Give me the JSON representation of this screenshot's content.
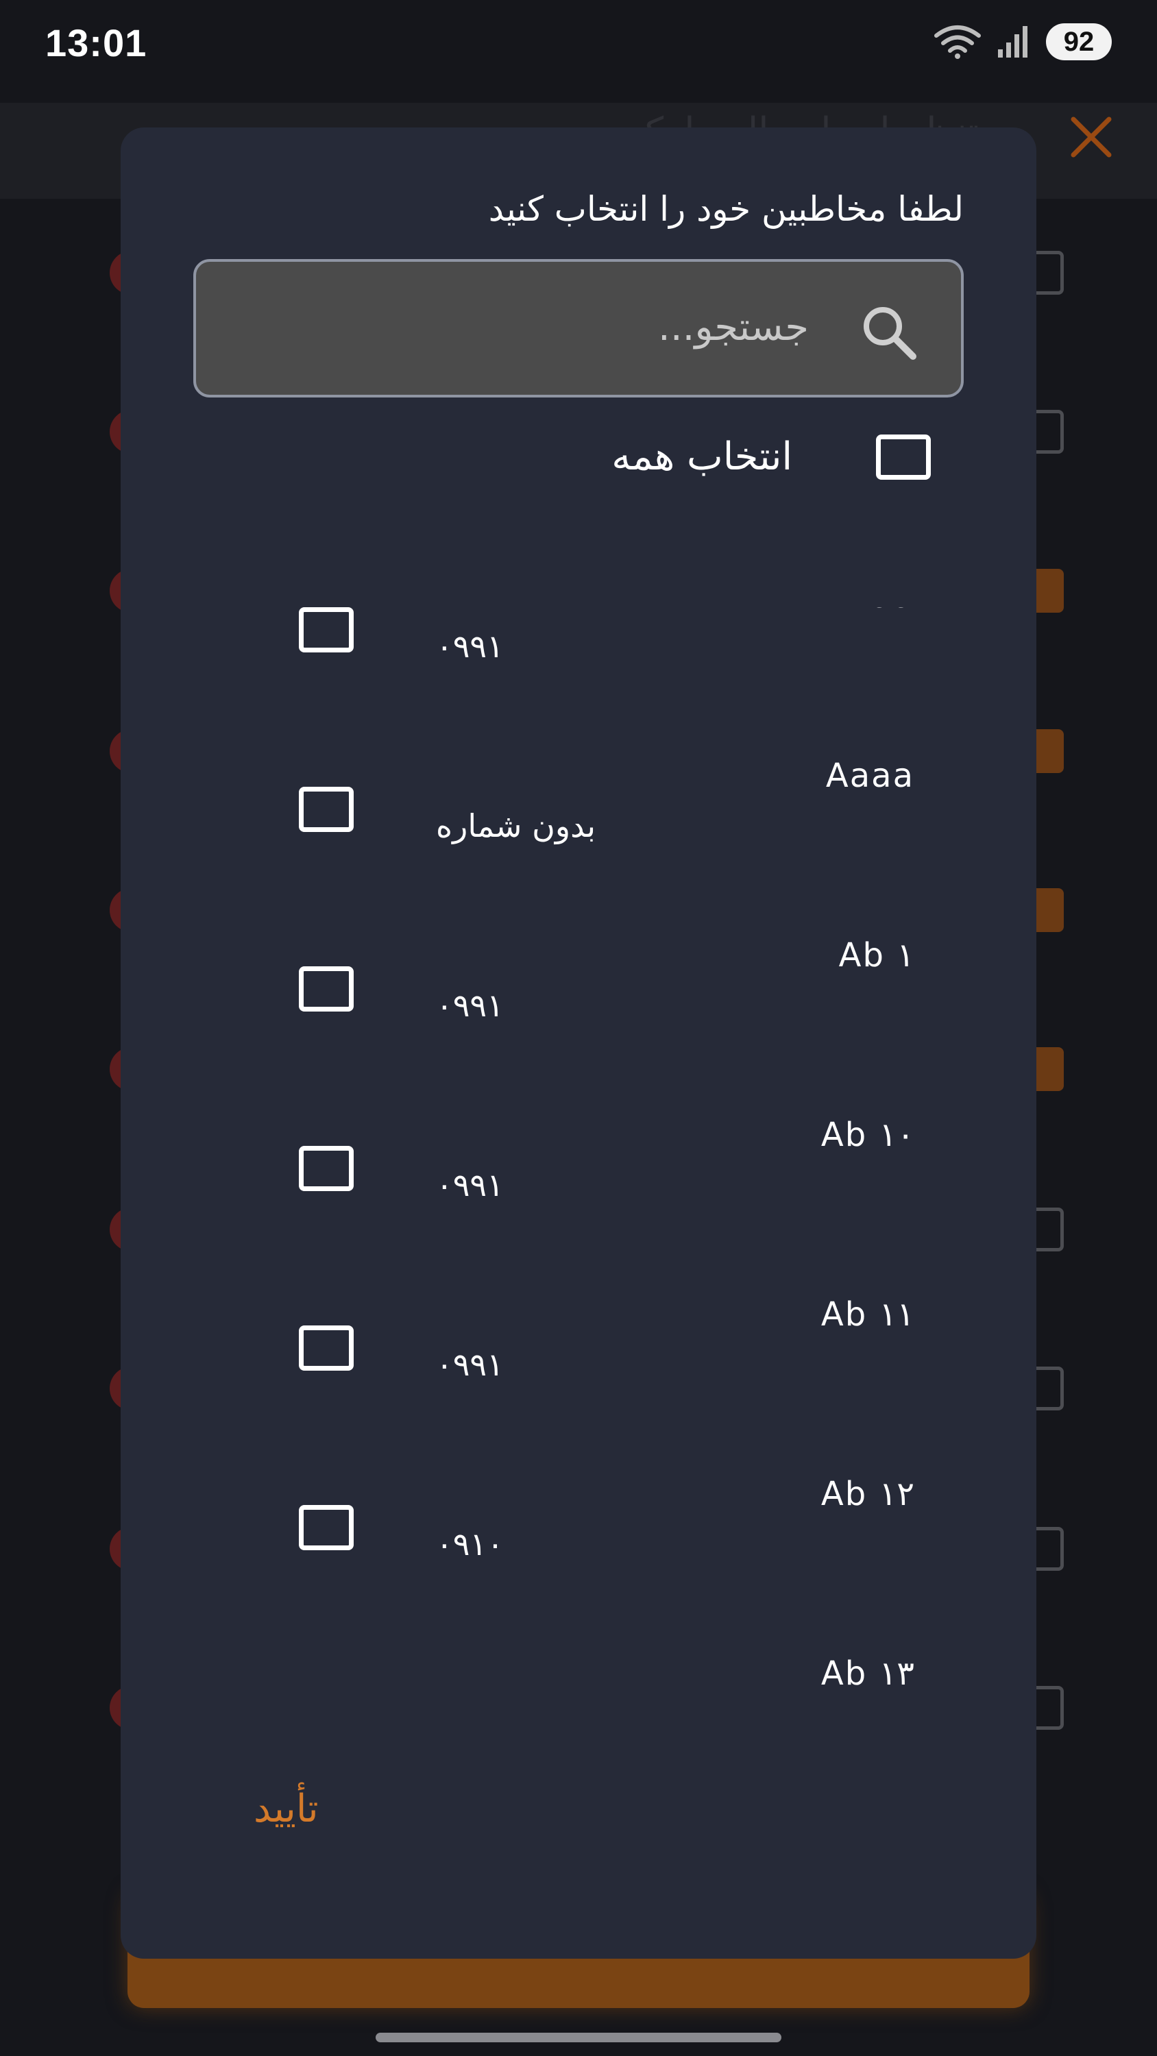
{
  "status_bar": {
    "time": "13:01",
    "battery": "92"
  },
  "background": {
    "header_title": "تنظیمات ارسال پیامک"
  },
  "modal": {
    "title": "لطفا مخاطبین خود را انتخاب کنید",
    "search": {
      "placeholder": "جستجو..."
    },
    "select_all": {
      "label": "انتخاب همه",
      "checked": false
    },
    "contacts": [
      {
        "name": "Aaa",
        "phone": "۰۹۹۱",
        "checked": false
      },
      {
        "name": "Aaaa",
        "phone": "بدون شماره",
        "checked": false
      },
      {
        "name": "Ab ۱",
        "phone": "۰۹۹۱",
        "checked": false
      },
      {
        "name": "Ab ۱۰",
        "phone": "۰۹۹۱",
        "checked": false
      },
      {
        "name": "Ab ۱۱",
        "phone": "۰۹۹۱",
        "checked": false
      },
      {
        "name": "Ab ۱۲",
        "phone": "۰۹۱۰",
        "checked": false
      },
      {
        "name": "Ab ۱۳",
        "phone": "",
        "checked": false
      }
    ],
    "confirm_label": "تأیید"
  },
  "colors": {
    "modal_bg": "#262a38",
    "accent": "#d47a2a",
    "search_bg": "#4b4b4b"
  }
}
